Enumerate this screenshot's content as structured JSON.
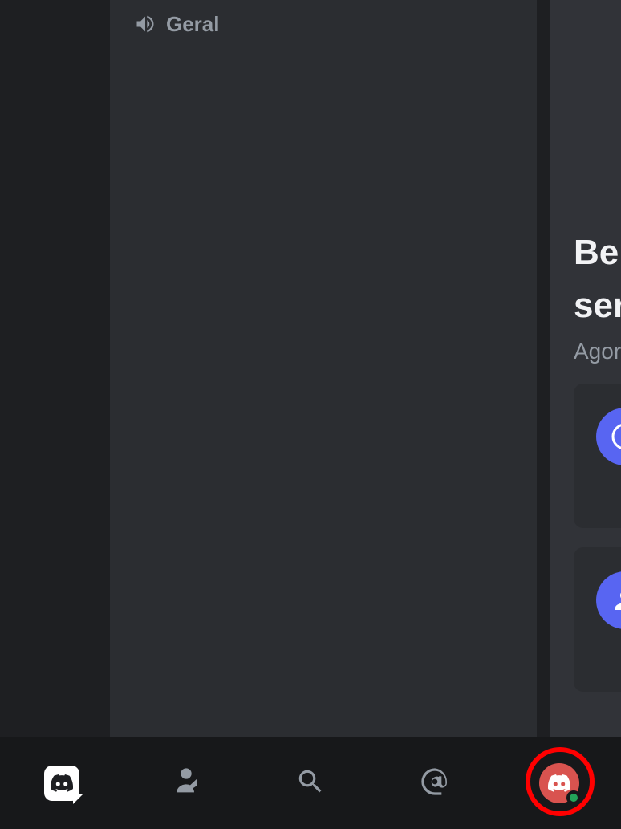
{
  "channel": {
    "voice_name": "Geral"
  },
  "chat": {
    "welcome_line1": "Bem-vindo ao",
    "welcome_line2": "servidor",
    "timestamp": "Agora"
  },
  "nav": {
    "home": "discord-home",
    "friends": "friends",
    "search": "search",
    "mentions": "mentions",
    "profile": "profile"
  },
  "status": {
    "presence": "online"
  }
}
